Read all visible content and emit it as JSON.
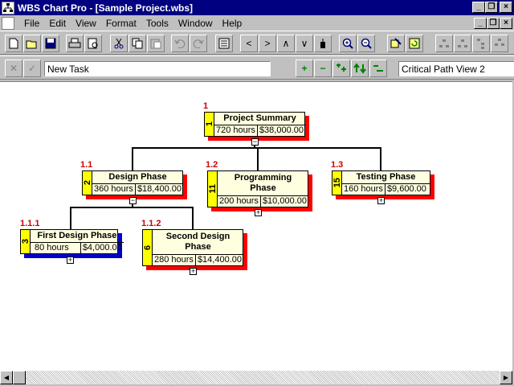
{
  "window": {
    "title": "WBS Chart Pro - [Sample Project.wbs]"
  },
  "menu": [
    {
      "label": "File"
    },
    {
      "label": "Edit"
    },
    {
      "label": "View"
    },
    {
      "label": "Format"
    },
    {
      "label": "Tools"
    },
    {
      "label": "Window"
    },
    {
      "label": "Help"
    }
  ],
  "window_buttons": {
    "minimize": "_",
    "restore": "❐",
    "close": "×"
  },
  "toolbar1": {
    "icons": [
      "new-icon",
      "open-icon",
      "save-icon",
      "print-icon",
      "print-preview-icon",
      "cut-icon",
      "copy-icon",
      "paste-icon",
      "undo-icon",
      "redo-icon",
      "properties-icon",
      "move-left-icon",
      "move-right-icon",
      "move-up-icon",
      "move-down-icon",
      "delete-icon",
      "zoom-in-icon",
      "zoom-out-icon",
      "chart-style-icon",
      "refresh-icon",
      "layout-1-icon",
      "layout-2-icon",
      "layout-3-icon",
      "layout-4-icon"
    ],
    "glyphs": {
      "left": "<",
      "right": ">",
      "up": "∧",
      "down": "∨",
      "zoom_in": "+",
      "zoom_out": "−"
    }
  },
  "toolbar2": {
    "cancel_glyph": "✕",
    "accept_glyph": "✓",
    "task_name": "New Task",
    "add_glyph": "+",
    "remove_glyph": "−",
    "view": "Critical Path View 2"
  },
  "chart": {
    "nodes": [
      {
        "id": "n1",
        "wbs": "1",
        "number": "1",
        "name": "Project Summary",
        "hours": "720 hours",
        "cost": "$38,000.00",
        "expander": "−",
        "shadow": "#ff0000"
      },
      {
        "id": "n2",
        "wbs": "1.1",
        "number": "2",
        "name": "Design Phase",
        "hours": "360 hours",
        "cost": "$18,400.00",
        "expander": "−",
        "shadow": "#ff0000"
      },
      {
        "id": "n3",
        "wbs": "1.2",
        "number": "11",
        "name": "Programming Phase",
        "hours": "200 hours",
        "cost": "$10,000.00",
        "expander": "+",
        "shadow": "#ff0000"
      },
      {
        "id": "n4",
        "wbs": "1.3",
        "number": "15",
        "name": "Testing Phase",
        "hours": "160 hours",
        "cost": "$9,600.00",
        "expander": "+",
        "shadow": "#ff0000"
      },
      {
        "id": "n5",
        "wbs": "1.1.1",
        "number": "3",
        "name": "First Design Phase",
        "hours": "80 hours",
        "cost": "$4,000.00",
        "expander": "+",
        "shadow": "#0000cc"
      },
      {
        "id": "n6",
        "wbs": "1.1.2",
        "number": "6",
        "name": "Second Design Phase",
        "hours": "280 hours",
        "cost": "$14,400.00",
        "expander": "+",
        "shadow": "#ff0000"
      }
    ]
  },
  "scrollbar": {
    "left_glyph": "◀",
    "right_glyph": "▶"
  }
}
